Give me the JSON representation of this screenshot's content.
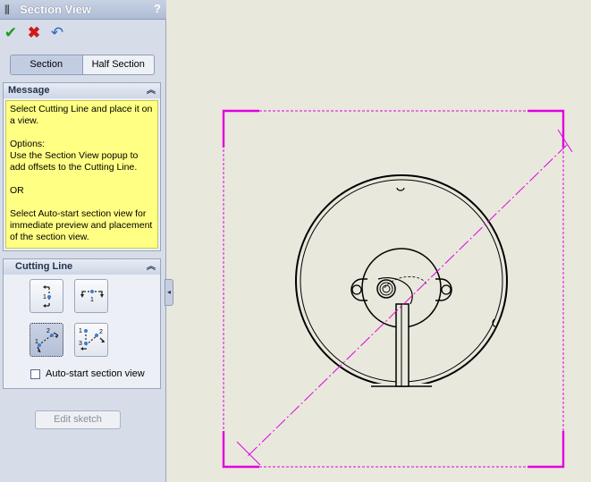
{
  "panel": {
    "title": "Section View",
    "help": "?",
    "actions": {
      "ok": "✔",
      "cancel": "✖",
      "undo": "↶"
    },
    "tabs": [
      {
        "label": "Section",
        "selected": true
      },
      {
        "label": "Half Section",
        "selected": false
      }
    ],
    "message": {
      "header": "Message",
      "paragraphs": [
        "Select Cutting Line and place it on a view.",
        "Options:\nUse the Section View popup to add offsets to the Cutting Line.",
        "OR",
        "Select Auto-start section view for immediate preview and placement of the section view."
      ]
    },
    "cutting_line": {
      "header": "Cutting Line",
      "buttons": [
        "vertical-line",
        "horizontal-line",
        "auxiliary-line",
        "aligned-line"
      ],
      "selected": "auxiliary-line",
      "auto_start_label": "Auto-start section view",
      "auto_start_checked": false
    },
    "edit_sketch_label": "Edit sketch"
  },
  "colors": {
    "accent": "#e000e0",
    "panel_bg": "#d6dde9",
    "message_bg": "#ffff83",
    "canvas_bg": "#e9e8dd"
  }
}
